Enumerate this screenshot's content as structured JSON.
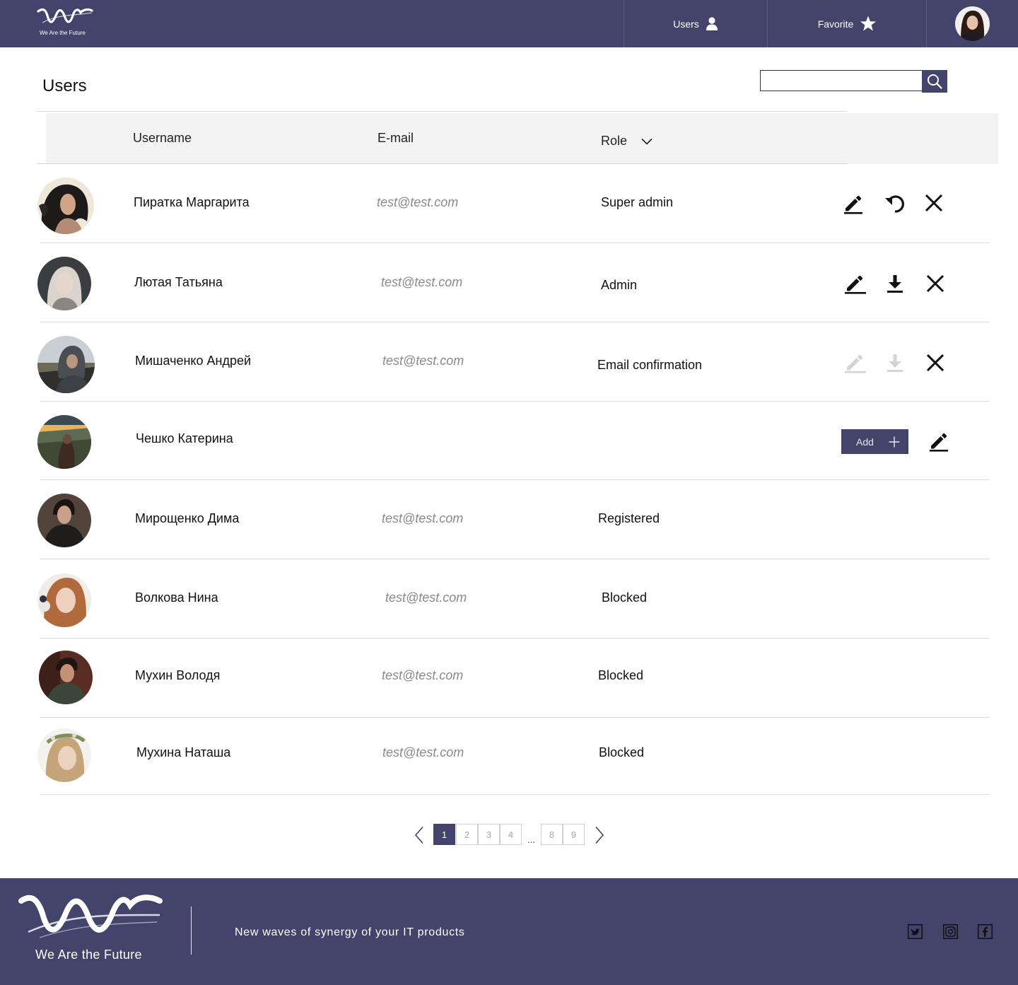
{
  "brand": {
    "logo_tagline": "We Are the Future",
    "footer_tagline": "We Are the Future",
    "slogan": "New waves of synergy of your IT products"
  },
  "colors": {
    "primary": "#43436b",
    "header_bg": "#43436b",
    "footer_bg": "#43436b",
    "table_header_bg": "#f3f3f3",
    "disabled_icon": "#d4d4d4"
  },
  "nav": {
    "users_label": "Users",
    "users_icon": "user-icon",
    "favorite_label": "Favorite",
    "favorite_icon": "star-icon"
  },
  "page": {
    "title": "Users"
  },
  "search": {
    "value": "",
    "placeholder": "",
    "icon": "search-icon"
  },
  "table": {
    "columns": {
      "username": "Username",
      "email": "E-mail",
      "role": "Role"
    },
    "role_sort_icon": "chevron-down-icon"
  },
  "rows": [
    {
      "username": "Пиратка Маргарита",
      "email": "test@test.com",
      "role": "Super admin",
      "actions": [
        "edit-icon",
        "undo-icon",
        "close-icon"
      ]
    },
    {
      "username": "Лютая Татьяна",
      "email": "test@test.com",
      "role": "Admin",
      "actions": [
        "edit-icon",
        "download-icon",
        "close-icon"
      ]
    },
    {
      "username": "Мишаченко Андрей",
      "email": "test@test.com",
      "role": "Email confirmation",
      "actions": [
        "edit-icon (disabled)",
        "download-icon (disabled)",
        "close-icon"
      ]
    },
    {
      "username": "Чешко Катерина",
      "email": "",
      "role": "",
      "add_label": "Add",
      "actions": [
        "plus-icon",
        "edit-icon"
      ]
    },
    {
      "username": "Мирощенко Дима",
      "email": "test@test.com",
      "role": "Registered"
    },
    {
      "username": "Волкова Нина",
      "email": "test@test.com",
      "role": "Blocked"
    },
    {
      "username": "Мухин Володя",
      "email": "test@test.com",
      "role": "Blocked"
    },
    {
      "username": "Мухина Наташа",
      "email": "test@test.com",
      "role": "Blocked"
    }
  ],
  "pagination": {
    "pages": [
      "1",
      "2",
      "3",
      "4",
      "8",
      "9"
    ],
    "current": "1",
    "ellipsis": "...",
    "prev_icon": "chevron-left-icon",
    "next_icon": "chevron-right-icon"
  },
  "social": [
    "twitter-icon",
    "instagram-icon",
    "facebook-icon"
  ]
}
